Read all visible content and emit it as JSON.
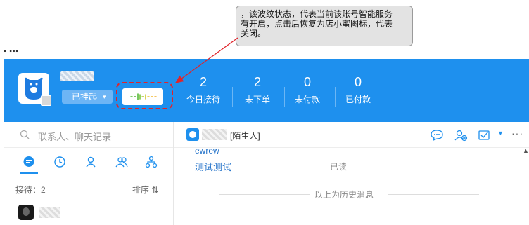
{
  "annotation": {
    "text": "，该波纹状态，代表当前该账号智能服务有开启，点击后恢复为店小蜜图标，代表关闭。",
    "line1": "，该波纹状态，代表当前该账号智能服务",
    "line2": "有开启，点击后恢复为店小蜜图标，代表",
    "line3": "关闭。",
    "highlight_color": "#e0242b"
  },
  "header": {
    "bg_color": "#1e90ee",
    "status_label": "已挂起",
    "status_caret": "▾",
    "stats": [
      {
        "value": "2",
        "label": "今日接待"
      },
      {
        "value": "2",
        "label": "未下单"
      },
      {
        "value": "0",
        "label": "未付款"
      },
      {
        "value": "0",
        "label": "已付款"
      }
    ]
  },
  "left_panel": {
    "search_placeholder": "联系人、聊天记录",
    "tabs": [
      "chat-icon",
      "clock-icon",
      "person-icon",
      "group-icon",
      "org-icon"
    ],
    "reception_label": "接待：2",
    "sort_label": "排序 ⇅"
  },
  "chat": {
    "contact_tag": "[陌生人]",
    "messages": [
      {
        "text": "ewrew"
      },
      {
        "text": "测试测试",
        "status": "已读"
      }
    ],
    "history_divider": "以上为历史消息",
    "more": "···"
  }
}
